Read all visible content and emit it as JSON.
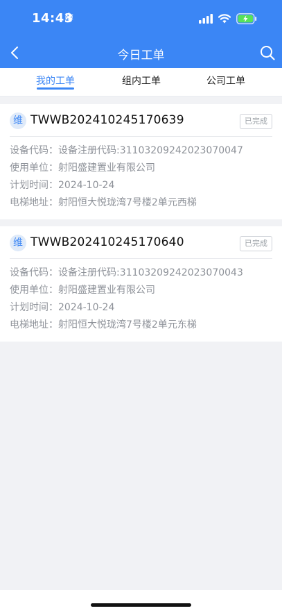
{
  "status_bar": {
    "time": "14:43",
    "snow_glyph": "❄",
    "icons": [
      "signal-icon",
      "wifi-icon",
      "battery-charging-icon"
    ],
    "battery_color": "#58e25a"
  },
  "nav": {
    "title": "今日工单",
    "back_icon": "chevron-left-icon",
    "search_icon": "search-icon"
  },
  "tabs": [
    {
      "label": "我的工单",
      "active": true
    },
    {
      "label": "组内工单",
      "active": false
    },
    {
      "label": "公司工单",
      "active": false
    }
  ],
  "work_orders": [
    {
      "badge": "维",
      "order_no": "TWWB202410245170639",
      "status": "已完成",
      "rows": [
        {
          "label": "设备代码：",
          "value": "设备注册代码:31103209242023070047"
        },
        {
          "label": "使用单位：",
          "value": "射阳盛建置业有限公司"
        },
        {
          "label": "计划时间：",
          "value": "2024-10-24"
        },
        {
          "label": "电梯地址：",
          "value": "射阳恒大悦珑湾7号楼2单元西梯"
        }
      ]
    },
    {
      "badge": "维",
      "order_no": "TWWB202410245170640",
      "status": "已完成",
      "rows": [
        {
          "label": "设备代码：",
          "value": "设备注册代码:31103209242023070043"
        },
        {
          "label": "使用单位：",
          "value": "射阳盛建置业有限公司"
        },
        {
          "label": "计划时间：",
          "value": "2024-10-24"
        },
        {
          "label": "电梯地址：",
          "value": "射阳恒大悦珑湾7号楼2单元东梯"
        }
      ]
    }
  ],
  "colors": {
    "accent": "#3b86f5",
    "background": "#f1f2f5",
    "muted_text": "#8e9299"
  }
}
